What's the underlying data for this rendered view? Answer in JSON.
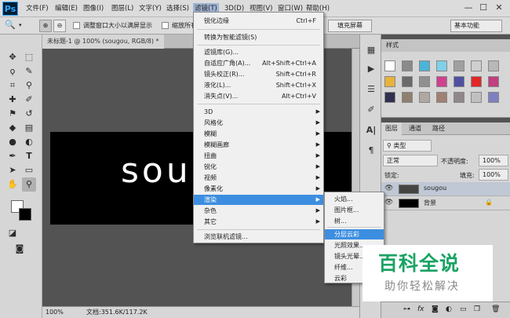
{
  "app": {
    "logo": "Ps"
  },
  "menubar": {
    "items": [
      "文件(F)",
      "编辑(E)",
      "图像(I)",
      "图层(L)",
      "文字(Y)",
      "选择(S)",
      "滤镜(T)",
      "3D(D)",
      "视图(V)",
      "窗口(W)",
      "帮助(H)"
    ],
    "window_buttons": [
      "—",
      "☐",
      "✕"
    ]
  },
  "options_bar": {
    "zoom_checkbox_label": "调整窗口大小以满屏显示",
    "zoom_all_label": "缩放所有",
    "fill_screen_button": "填充屏幕",
    "workspace": "基本功能"
  },
  "document": {
    "tab_title": "未标题-1 @ 100% (sougou, RGB/8) *",
    "canvas_text": "sou",
    "zoom": "100%",
    "doc_info": "文档:351.6K/117.2K"
  },
  "styles_panel": {
    "title": "样式"
  },
  "layers_panel": {
    "tabs": [
      "图层",
      "通道",
      "路径"
    ],
    "filter_type": "类型",
    "blend_mode": "正常",
    "opacity_label": "不透明度:",
    "opacity_value": "100%",
    "lock_label": "锁定:",
    "fill_label": "填充:",
    "fill_value": "100%",
    "layers": [
      {
        "name": "sougou"
      },
      {
        "name": "背景"
      }
    ]
  },
  "filter_menu": {
    "items": [
      {
        "label": "锐化边缘",
        "shortcut": "Ctrl+F"
      },
      {
        "label": "转换为智能滤镜(S)",
        "shortcut": ""
      },
      {
        "label": "滤镜库(G)...",
        "shortcut": ""
      },
      {
        "label": "自适应广角(A)...",
        "shortcut": "Alt+Shift+Ctrl+A"
      },
      {
        "label": "镜头校正(R)...",
        "shortcut": "Shift+Ctrl+R"
      },
      {
        "label": "液化(L)...",
        "shortcut": "Shift+Ctrl+X"
      },
      {
        "label": "消失点(V)...",
        "shortcut": "Alt+Ctrl+V"
      },
      {
        "label": "3D",
        "shortcut": ""
      },
      {
        "label": "风格化",
        "shortcut": ""
      },
      {
        "label": "模糊",
        "shortcut": ""
      },
      {
        "label": "模糊画廊",
        "shortcut": ""
      },
      {
        "label": "扭曲",
        "shortcut": ""
      },
      {
        "label": "锐化",
        "shortcut": ""
      },
      {
        "label": "视频",
        "shortcut": ""
      },
      {
        "label": "像素化",
        "shortcut": ""
      },
      {
        "label": "渲染",
        "shortcut": ""
      },
      {
        "label": "杂色",
        "shortcut": ""
      },
      {
        "label": "其它",
        "shortcut": ""
      },
      {
        "label": "浏览联机滤镜...",
        "shortcut": ""
      }
    ]
  },
  "render_submenu": {
    "items": [
      "火焰...",
      "图片框...",
      "树...",
      "分层云彩",
      "光照效果...",
      "镜头光晕...",
      "纤维...",
      "云彩"
    ]
  },
  "watermark": {
    "title": "百科全说",
    "subtitle": "助你轻松解决"
  },
  "colors": {
    "highlight": "#3d8ee0",
    "watermark_green": "#1aa363"
  }
}
